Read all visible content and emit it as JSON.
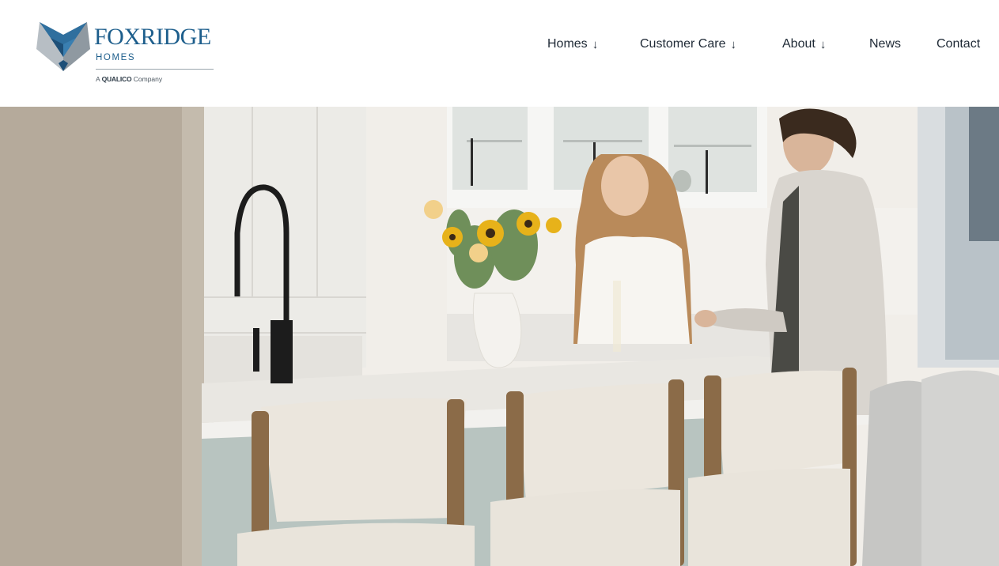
{
  "brand": {
    "name": "FOXRIDGE",
    "sub": "HOMES",
    "tagline_prefix": "A",
    "tagline_brand": "QUALICO",
    "tagline_suffix": "Company",
    "colors": {
      "primary": "#1d5e8c",
      "accent": "#2f6f9e",
      "text": "#1f2a36"
    }
  },
  "nav": {
    "items": [
      {
        "label": "Homes",
        "arrow": "↓"
      },
      {
        "label": "Customer Care",
        "arrow": "↓"
      },
      {
        "label": "About",
        "arrow": "↓"
      },
      {
        "label": "News"
      },
      {
        "label": "Contact"
      }
    ]
  },
  "hero": {
    "image": "kitchen-couple-photo"
  }
}
